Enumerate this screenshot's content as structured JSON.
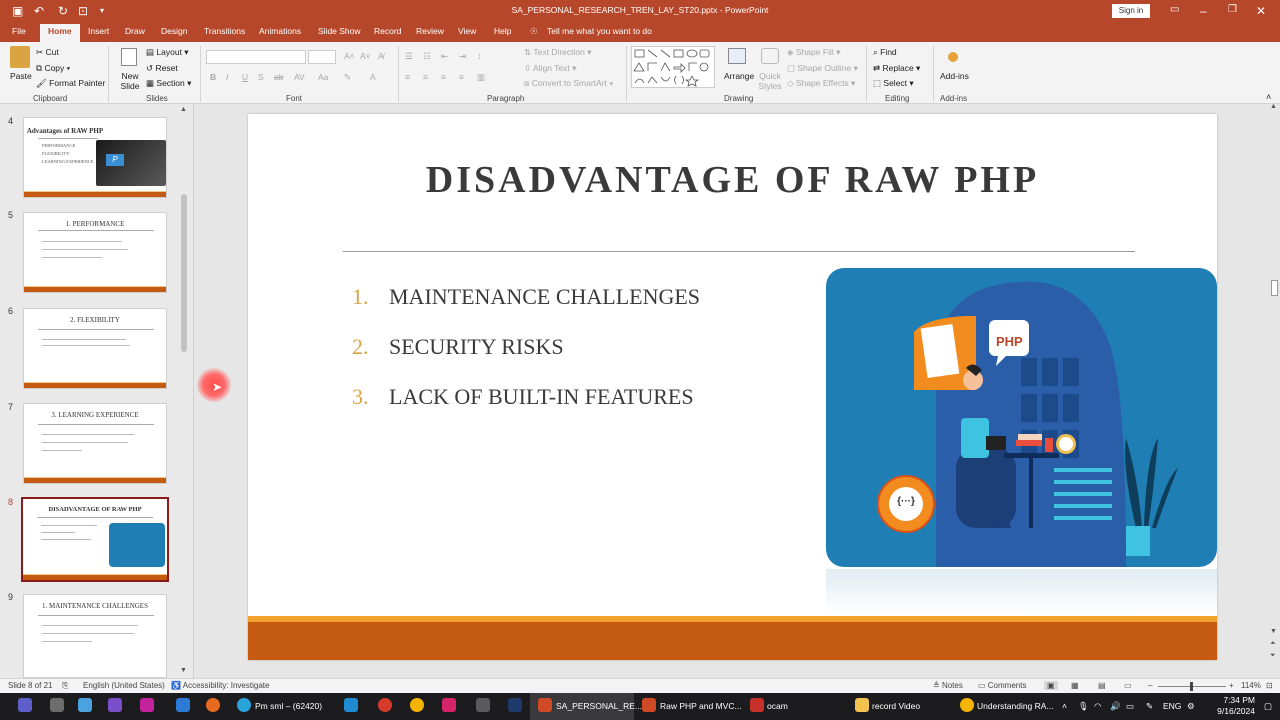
{
  "window": {
    "file_title": "SA_PERSONAL_RESEARCH_TREN_LAY_ST20.pptx",
    "app_name": "PowerPoint",
    "signin_label": "Sign in"
  },
  "tabs": [
    "File",
    "Home",
    "Insert",
    "Draw",
    "Design",
    "Transitions",
    "Animations",
    "Slide Show",
    "Record",
    "Review",
    "View",
    "Help"
  ],
  "active_tab": "Home",
  "tell_me": "Tell me what you want to do",
  "ribbon": {
    "clipboard": {
      "paste": "Paste",
      "cut": "Cut",
      "copy": "Copy",
      "format_painter": "Format Painter",
      "label": "Clipboard"
    },
    "slides": {
      "new_slide": "New Slide",
      "layout": "Layout",
      "reset": "Reset",
      "section": "Section",
      "label": "Slides"
    },
    "font": {
      "label": "Font"
    },
    "paragraph": {
      "text_direction": "Text Direction",
      "align_text": "Align Text",
      "convert_smartart": "Convert to SmartArt",
      "label": "Paragraph"
    },
    "drawing": {
      "arrange": "Arrange",
      "quick_styles": "Quick Styles",
      "shape_fill": "Shape Fill",
      "shape_outline": "Shape Outline",
      "shape_effects": "Shape Effects",
      "label": "Drawing"
    },
    "editing": {
      "find": "Find",
      "replace": "Replace",
      "select": "Select",
      "label": "Editing"
    },
    "addins": {
      "addins": "Add-ins",
      "label": "Add-ins"
    }
  },
  "thumbnails": [
    {
      "num": "4",
      "title": "Advantages of RAW PHP",
      "selected": false
    },
    {
      "num": "5",
      "title": "1. PERFORMANCE",
      "selected": false
    },
    {
      "num": "6",
      "title": "2. FLEXIBILITY",
      "selected": false
    },
    {
      "num": "7",
      "title": "3. LEARNING EXPERIENCE",
      "selected": false
    },
    {
      "num": "8",
      "title": "DISADVANTAGE OF RAW PHP",
      "selected": true
    },
    {
      "num": "9",
      "title": "1. MAINTENANCE CHALLENGES",
      "selected": false
    }
  ],
  "thumb4_items": [
    "PERFORMANCE",
    "FLEXIBILITY",
    "LEARNING EXPERIENCE"
  ],
  "slide": {
    "title": "DISADVANTAGE OF RAW PHP",
    "items": [
      {
        "num": "1.",
        "text": "MAINTENANCE CHALLENGES"
      },
      {
        "num": "2.",
        "text": "SECURITY RISKS"
      },
      {
        "num": "3.",
        "text": "LACK OF BUILT-IN FEATURES"
      }
    ],
    "php_label": "PHP",
    "code_label": "{···}"
  },
  "status": {
    "slide_of": "Slide 8 of 21",
    "language": "English (United States)",
    "accessibility": "Accessibility: Investigate",
    "notes": "Notes",
    "comments": "Comments",
    "zoom": "114%"
  },
  "taskbar": {
    "items": [
      "Pm sml – (62420)",
      "SA_PERSONAL_RE...",
      "Raw PHP and MVC...",
      "ocam",
      "record Video",
      "Understanding RA..."
    ],
    "lang": "ENG",
    "time": "7:34 PM",
    "date": "9/16/2024"
  },
  "colors": {
    "accent": "#b7472a",
    "slide_bar": "#c55a11",
    "number_color": "#d9a441",
    "illustration_bg": "#1f7fb5"
  }
}
